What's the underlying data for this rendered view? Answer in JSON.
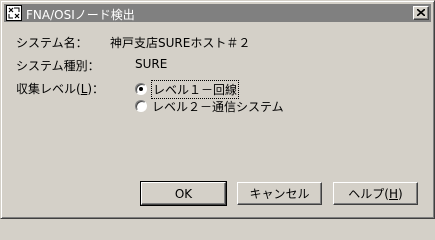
{
  "window": {
    "title": "FNA/OSIノード検出"
  },
  "form": {
    "system_name_label": "システム名：",
    "system_name_value": "神戸支店SUREホスト＃２",
    "system_type_label": "システム種別：",
    "system_type_value": "SURE",
    "collect_level_label_before": "収集レベル(",
    "collect_level_label_key": "L",
    "collect_level_label_after": ")：",
    "options": [
      {
        "label": "レベル１－回線",
        "checked": true
      },
      {
        "label": "レベル２－通信システム",
        "checked": false
      }
    ]
  },
  "buttons": {
    "ok": "OK",
    "cancel": "キャンセル",
    "help_before": "ヘルプ(",
    "help_key": "H",
    "help_after": ")"
  },
  "icons": {
    "title": "app-icon",
    "close": "close-icon"
  }
}
